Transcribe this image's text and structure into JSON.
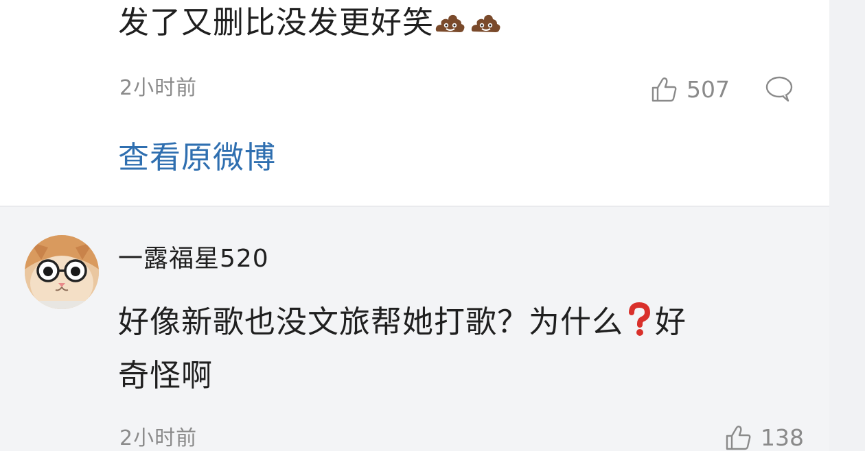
{
  "comments": [
    {
      "text_prefix": "发了又删比没发更好笑",
      "text_emoji": "💩💩",
      "time": "2小时前",
      "likes": "507",
      "action_link": "查看原微博"
    },
    {
      "username": "一露福星520",
      "text_line1_a": "好像新歌也没文旅帮她打歌？为什么",
      "text_line1_emoji": "❓",
      "text_line1_b": "好",
      "text_line2": "奇怪啊",
      "time": "2小时前",
      "likes": "138"
    }
  ],
  "icons": {
    "like": "thumbs-up-icon",
    "comment": "speech-bubble-icon",
    "poop": "poop-emoji-icon",
    "question": "red-question-mark-icon"
  },
  "colors": {
    "link_blue": "#2f6fb0",
    "muted_gray": "#8a8a8a",
    "question_red": "#d9302b"
  }
}
